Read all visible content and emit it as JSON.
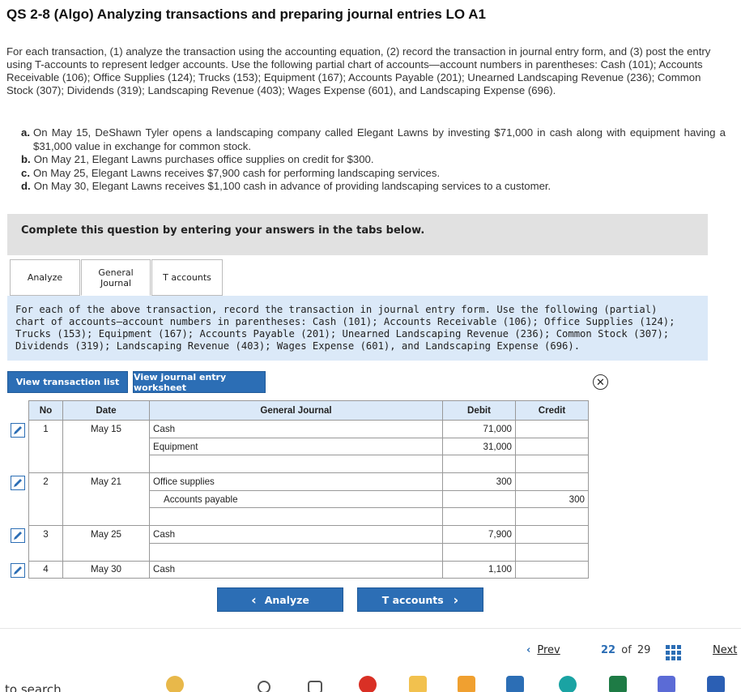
{
  "title": "QS 2-8 (Algo) Analyzing transactions and preparing journal entries LO A1",
  "intro": "For each transaction, (1) analyze the transaction using the accounting equation, (2) record the transaction in journal entry form, and (3) post the entry using T-accounts to represent ledger accounts. Use the following partial chart of accounts—account numbers in parentheses: Cash (101); Accounts Receivable (106); Office Supplies (124); Trucks (153); Equipment (167); Accounts Payable (201); Unearned Landscaping Revenue (236); Common Stock (307); Dividends (319); Landscaping Revenue (403); Wages Expense (601), and Landscaping Expense (696).",
  "transactions": [
    {
      "letter": "a.",
      "text": "On May 15, DeShawn Tyler opens a landscaping company called Elegant Lawns by investing $71,000 in cash along with equipment having a $31,000 value in exchange for common stock."
    },
    {
      "letter": "b.",
      "text": "On May 21, Elegant Lawns purchases office supplies on credit for $300."
    },
    {
      "letter": "c.",
      "text": "On May 25, Elegant Lawns receives $7,900 cash for performing landscaping services."
    },
    {
      "letter": "d.",
      "text": "On May 30, Elegant Lawns receives $1,100 cash in advance of providing landscaping services to a customer."
    }
  ],
  "complete_prompt": "Complete this question by entering your answers in the tabs below.",
  "tabs": [
    {
      "label": "Analyze"
    },
    {
      "label": "General Journal"
    },
    {
      "label": "T accounts"
    }
  ],
  "instruction": "For each of the above transaction, record the transaction in journal entry form. Use the following (partial) chart of accounts—account numbers in parentheses: Cash (101); Accounts Receivable (106); Office Supplies (124); Trucks (153); Equipment (167); Accounts Payable (201); Unearned Landscaping Revenue (236); Common Stock (307); Dividends (319); Landscaping Revenue (403); Wages Expense (601), and Landscaping Expense (696).",
  "buttons": {
    "view_transactions": "View transaction list",
    "view_worksheet": "View journal entry worksheet",
    "close": "✕"
  },
  "journal": {
    "headers": {
      "no": "No",
      "date": "Date",
      "general_journal": "General Journal",
      "debit": "Debit",
      "credit": "Credit"
    },
    "entries": [
      {
        "no": "1",
        "date": "May 15",
        "rows": [
          {
            "account": "Cash",
            "debit": "71,000",
            "credit": "",
            "indent": false
          },
          {
            "account": "Equipment",
            "debit": "31,000",
            "credit": "",
            "indent": false
          },
          {
            "account": "",
            "debit": "",
            "credit": "",
            "indent": false
          }
        ]
      },
      {
        "no": "2",
        "date": "May 21",
        "rows": [
          {
            "account": "Office supplies",
            "debit": "300",
            "credit": "",
            "indent": false
          },
          {
            "account": "Accounts payable",
            "debit": "",
            "credit": "300",
            "indent": true
          },
          {
            "account": "",
            "debit": "",
            "credit": "",
            "indent": false
          }
        ]
      },
      {
        "no": "3",
        "date": "May 25",
        "rows": [
          {
            "account": "Cash",
            "debit": "7,900",
            "credit": "",
            "indent": false
          },
          {
            "account": "",
            "debit": "",
            "credit": "",
            "indent": false
          }
        ]
      },
      {
        "no": "4",
        "date": "May 30",
        "rows": [
          {
            "account": "Cash",
            "debit": "1,100",
            "credit": "",
            "indent": false
          }
        ]
      }
    ]
  },
  "nav": {
    "analyze": "Analyze",
    "t_accounts": "T accounts",
    "prev_arrow": "‹",
    "next_arrow": "›"
  },
  "pager": {
    "prev": "Prev",
    "current": "22",
    "of": "of",
    "total": "29",
    "next": "Next"
  },
  "search_hint": "to search",
  "colors": {
    "accent": "#2c6eb5",
    "info_bg": "#dbe9f8",
    "complete_bg": "#e1e1e1"
  }
}
